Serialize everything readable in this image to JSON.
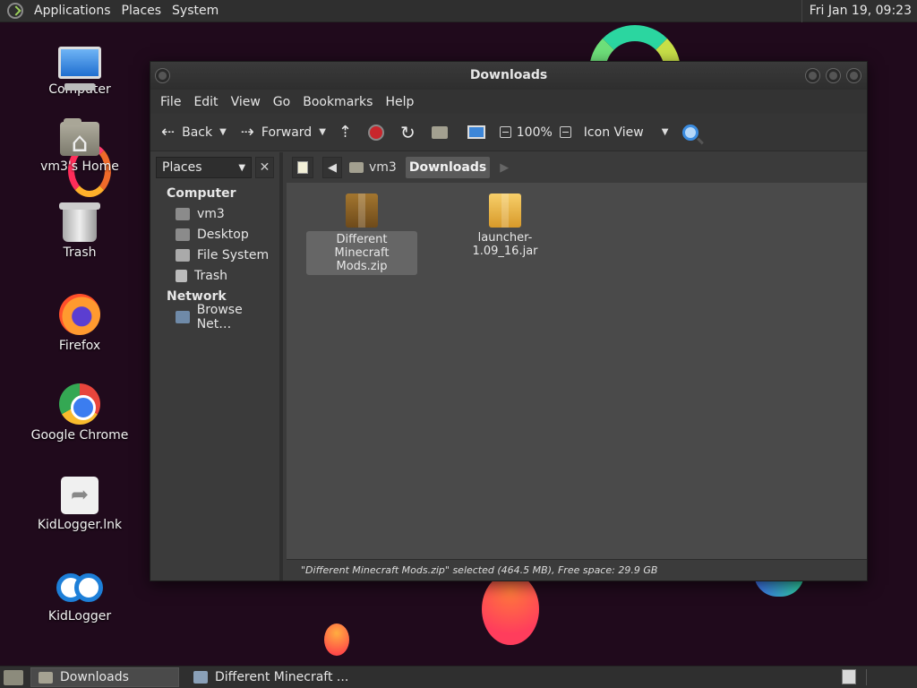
{
  "top_panel": {
    "menus": [
      "Applications",
      "Places",
      "System"
    ],
    "clock": "Fri Jan 19, 09:23"
  },
  "desktop": {
    "icons": [
      {
        "label": "Computer",
        "icon": "computer-icon"
      },
      {
        "label": "vm3's Home",
        "icon": "home-folder-icon"
      },
      {
        "label": "Trash",
        "icon": "trash-icon"
      },
      {
        "label": "Firefox",
        "icon": "firefox-icon"
      },
      {
        "label": "Google Chrome",
        "icon": "chrome-icon"
      },
      {
        "label": "KidLogger.lnk",
        "icon": "shortcut-icon"
      },
      {
        "label": "KidLogger",
        "icon": "binoculars-icon"
      }
    ]
  },
  "window": {
    "title": "Downloads",
    "menu": [
      "File",
      "Edit",
      "View",
      "Go",
      "Bookmarks",
      "Help"
    ],
    "toolbar": {
      "back": "Back",
      "forward": "Forward",
      "zoom": "100%",
      "view_mode": "Icon View"
    },
    "sidebar": {
      "selector": "Places",
      "close": "✕",
      "sections": [
        {
          "title": "Computer",
          "items": [
            "vm3",
            "Desktop",
            "File System",
            "Trash"
          ]
        },
        {
          "title": "Network",
          "items": [
            "Browse Net…"
          ]
        }
      ]
    },
    "pathbar": {
      "crumbs": [
        "vm3",
        "Downloads"
      ]
    },
    "files": [
      {
        "name": "Different Minecraft Mods.zip",
        "selected": true,
        "type": "zip"
      },
      {
        "name": "launcher-1.09_16.jar",
        "selected": false,
        "type": "jar"
      }
    ],
    "status": "\"Different Minecraft Mods.zip\" selected (464.5 MB), Free space: 29.9 GB"
  },
  "taskbar": {
    "tasks": [
      {
        "label": "Downloads",
        "active": true
      },
      {
        "label": "Different Minecraft ...",
        "active": false
      }
    ]
  }
}
